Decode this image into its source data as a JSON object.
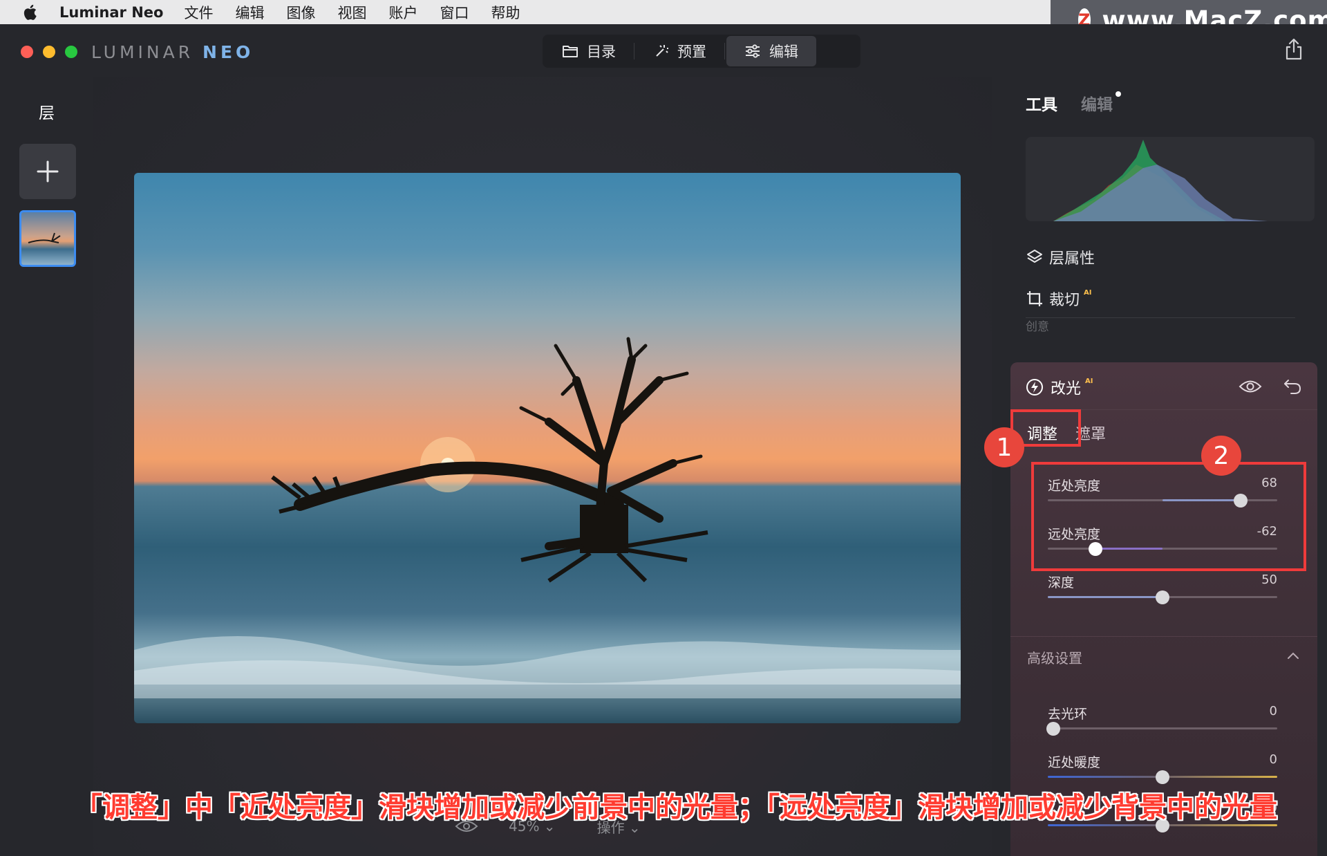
{
  "menubar": {
    "app_name": "Luminar Neo",
    "items": [
      "文件",
      "编辑",
      "图像",
      "视图",
      "账户",
      "窗口",
      "帮助"
    ]
  },
  "watermark": {
    "logo_letter": "Z",
    "text": "www.MacZ.com"
  },
  "brand": {
    "part1": "LUMINAR ",
    "part2": "NEO"
  },
  "modes": [
    {
      "label": "目录",
      "icon": "folder-icon"
    },
    {
      "label": "预置",
      "icon": "magic-wand-icon"
    },
    {
      "label": "编辑",
      "icon": "sliders-icon",
      "active": true
    }
  ],
  "layers": {
    "title": "层"
  },
  "viewer": {
    "zoom": "45%",
    "actions": "操作"
  },
  "right_panel": {
    "tab_tools": "工具",
    "tab_edits": "编辑",
    "tools": [
      {
        "label": "层属性",
        "icon": "layers-icon"
      },
      {
        "label": "裁切",
        "icon": "crop-icon",
        "ai": "AI"
      }
    ],
    "group_label": "创意"
  },
  "relight": {
    "title": "改光",
    "ai": "AI",
    "sub_tab_active": "调整",
    "sub_tab_other": "遮罩",
    "sliders": [
      {
        "label": "近处亮度",
        "value": 68
      },
      {
        "label": "远处亮度",
        "value": -62
      },
      {
        "label": "深度",
        "value": 50
      }
    ],
    "advanced": {
      "title": "高级设置",
      "sliders": [
        {
          "label": "去光环",
          "value": 0
        },
        {
          "label": "近处暖度",
          "value": 0
        },
        {
          "label": "",
          "value": 0
        }
      ]
    }
  },
  "annotations": {
    "badge1": "1",
    "badge2": "2",
    "caption": "「调整」中「近处亮度」滑块增加或减少前景中的光量；「远处亮度」滑块增加或减少背景中的光量"
  },
  "colors": {
    "accent_blue": "#3d8cf0",
    "annotation_red": "#ef3b3b",
    "ai_badge": "#ffc04d"
  }
}
